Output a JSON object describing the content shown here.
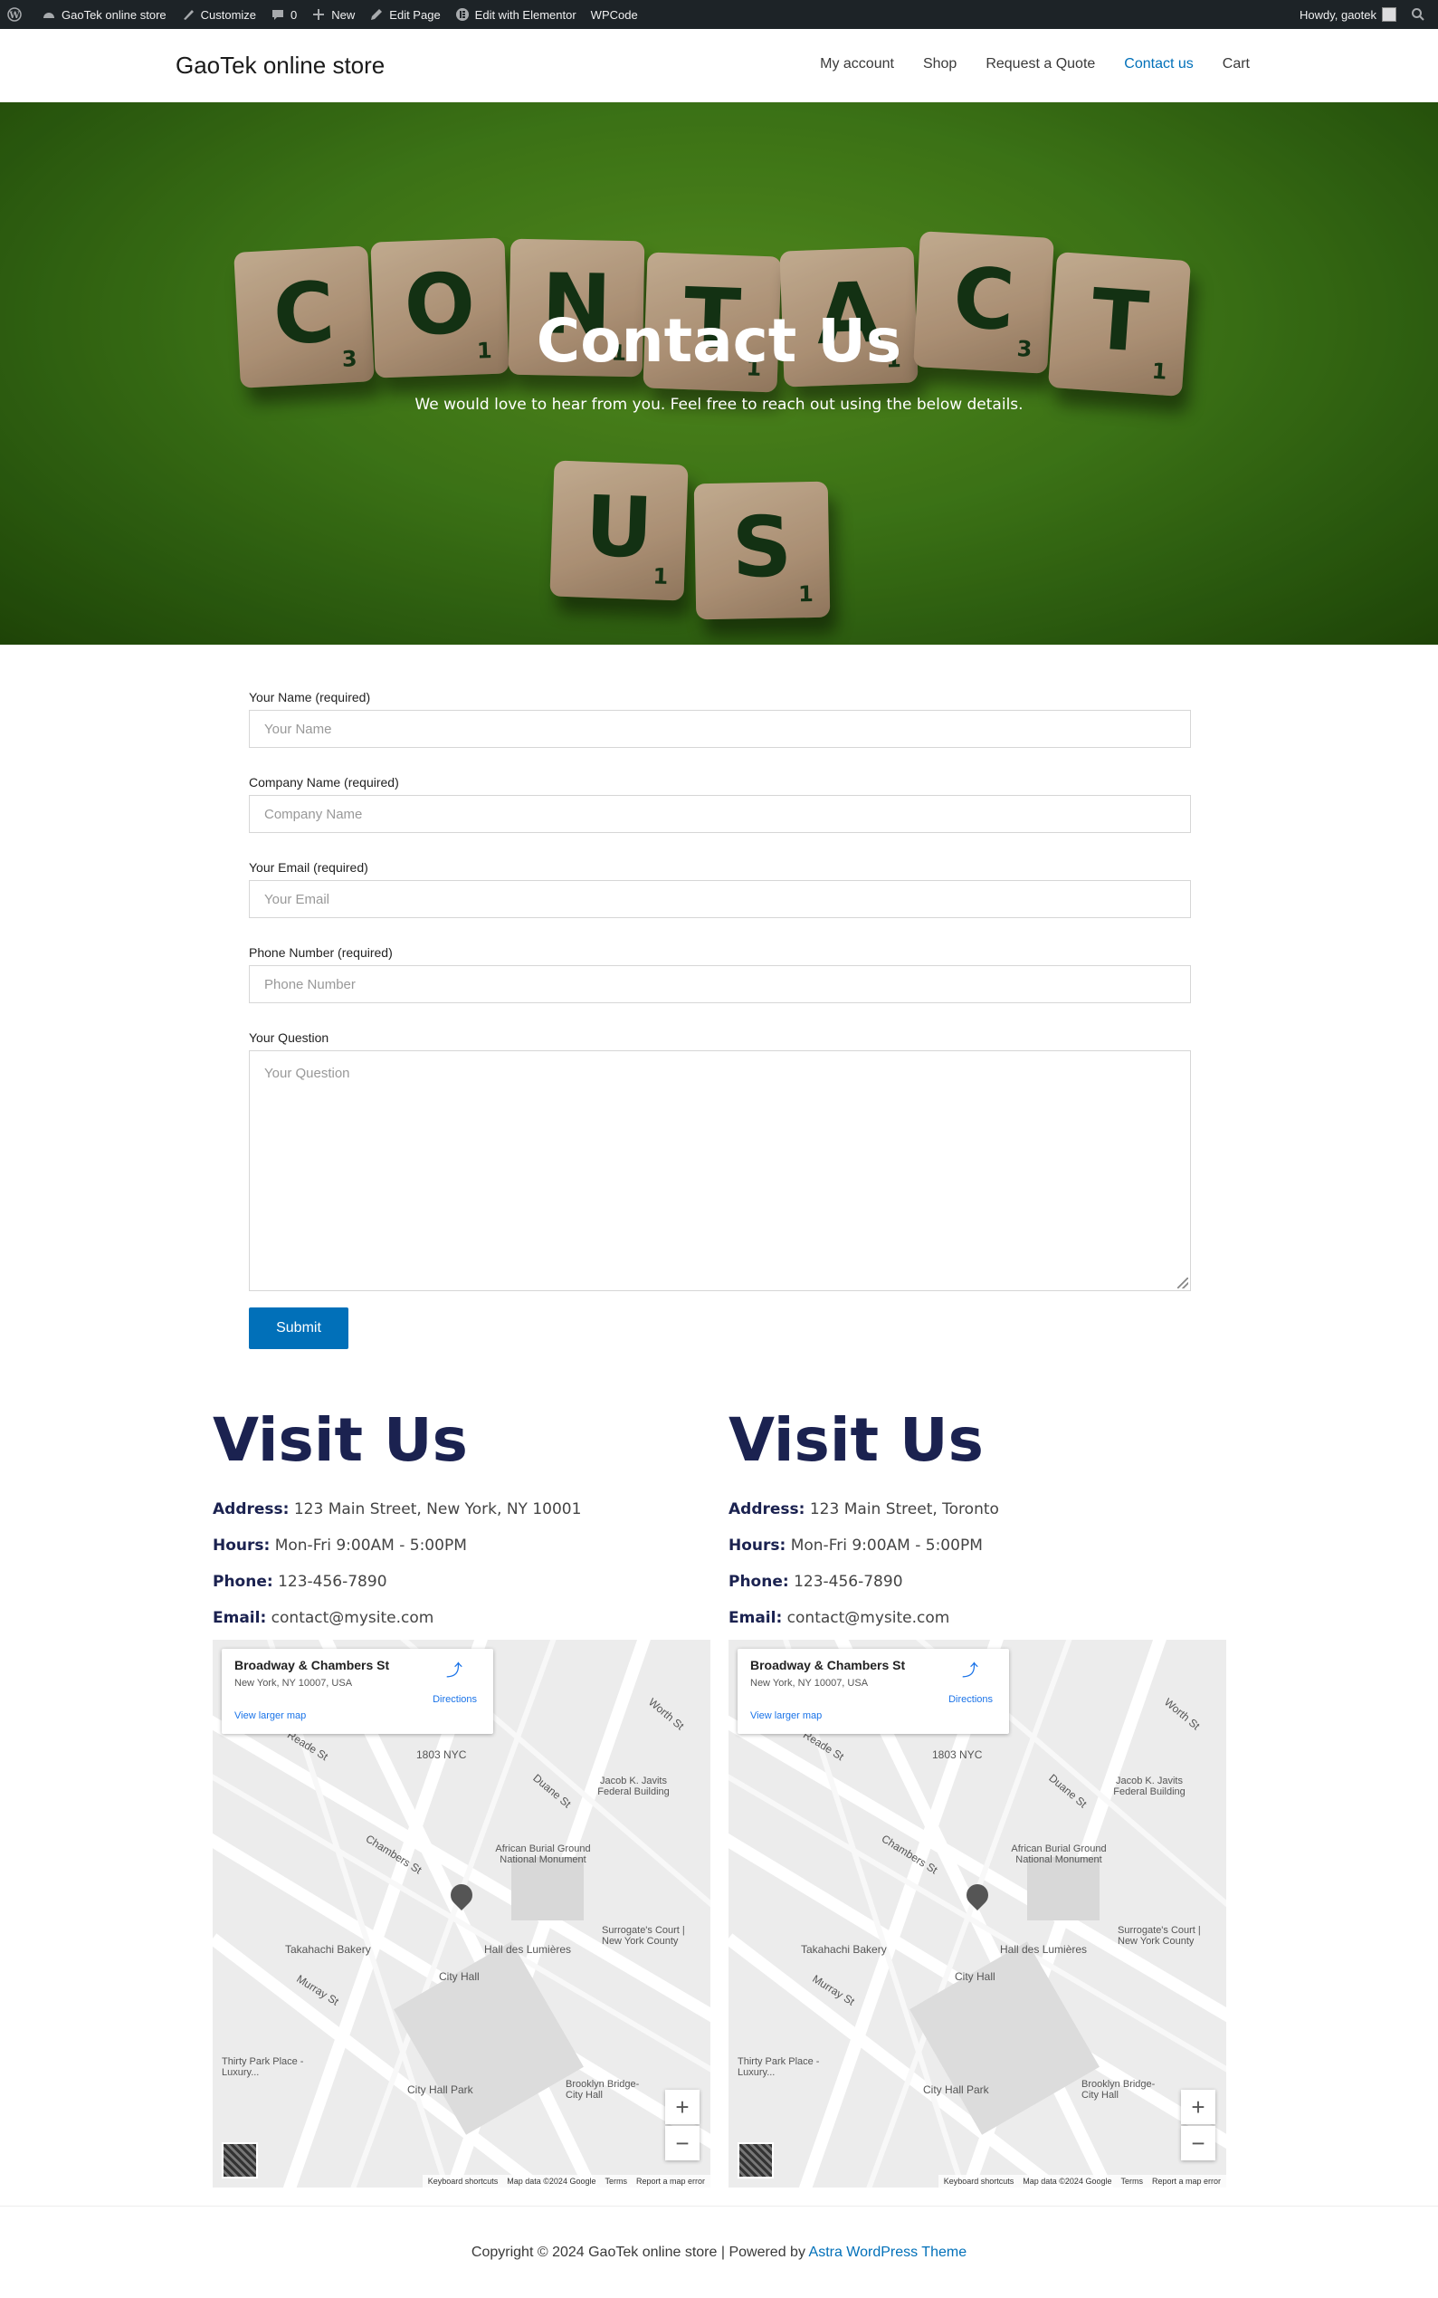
{
  "admin_bar": {
    "site_name": "GaoTek online store",
    "customize": "Customize",
    "comments_count": "0",
    "new": "New",
    "edit_page": "Edit Page",
    "edit_elementor": "Edit with Elementor",
    "wpcode": "WPCode",
    "howdy": "Howdy, gaotek"
  },
  "header": {
    "site_title": "GaoTek online store",
    "nav": [
      "My account",
      "Shop",
      "Request a Quote",
      "Contact us",
      "Cart"
    ],
    "active_nav": "Contact us"
  },
  "hero": {
    "title": "Contact Us",
    "subtitle": "We would love to hear from you. Feel free to reach out using the below details.",
    "tiles_top": [
      {
        "letter": "C",
        "score": "3"
      },
      {
        "letter": "O",
        "score": "1"
      },
      {
        "letter": "N",
        "score": "1"
      },
      {
        "letter": "T",
        "score": "1"
      },
      {
        "letter": "A",
        "score": "1"
      },
      {
        "letter": "C",
        "score": "3"
      },
      {
        "letter": "T",
        "score": "1"
      }
    ],
    "tiles_bottom": [
      {
        "letter": "U",
        "score": "1"
      },
      {
        "letter": "S",
        "score": "1"
      }
    ]
  },
  "form": {
    "name_label": "Your Name (required)",
    "name_placeholder": "Your Name",
    "company_label": "Company Name (required)",
    "company_placeholder": "Company Name",
    "email_label": "Your Email (required)",
    "email_placeholder": "Your Email",
    "phone_label": "Phone Number (required)",
    "phone_placeholder": "Phone Number",
    "question_label": "Your Question",
    "question_placeholder": "Your Question",
    "submit": "Submit"
  },
  "locations": [
    {
      "heading": "Visit Us",
      "address_label": "Address:",
      "address": "123 Main Street, New York, NY 10001",
      "hours_label": "Hours:",
      "hours": "Mon-Fri 9:00AM - 5:00PM",
      "phone_label": "Phone:",
      "phone": "123-456-7890",
      "email_label": "Email:",
      "email": "contact@mysite.com",
      "map": {
        "place": "Broadway & Chambers St",
        "place_address": "New York, NY 10007, USA",
        "larger_map": "View larger map",
        "directions": "Directions"
      }
    },
    {
      "heading": "Visit Us",
      "address_label": "Address:",
      "address": "123 Main Street, Toronto",
      "hours_label": "Hours:",
      "hours": "Mon-Fri 9:00AM - 5:00PM",
      "phone_label": "Phone:",
      "phone": "123-456-7890",
      "email_label": "Email:",
      "email": "contact@mysite.com",
      "map": {
        "place": "Broadway & Chambers St",
        "place_address": "New York, NY 10007, USA",
        "larger_map": "View larger map",
        "directions": "Directions"
      }
    }
  ],
  "map_labels": {
    "street1": "Chambers St",
    "street2": "Reade St",
    "street3": "Duane St",
    "street4": "Murray St",
    "street5": "Worth St",
    "poi1": "African Burial Ground National Monument",
    "poi2": "Hall des Lumières",
    "poi3": "City Hall",
    "poi4": "Takahachi Bakery",
    "poi5": "Jacob K. Javits Federal Building",
    "poi6": "Surrogate's Court | New York County",
    "poi7": "City Hall Park",
    "poi8": "1803 NYC",
    "poi9": "Thirty Park Place - Luxury...",
    "poi10": "Brooklyn Bridge-City Hall",
    "keyboard": "Keyboard shortcuts",
    "mapdata": "Map data ©2024 Google",
    "terms": "Terms",
    "report": "Report a map error",
    "google": "Google"
  },
  "footer": {
    "copyright": "Copyright © 2024 GaoTek online store | Powered by ",
    "theme_link": "Astra WordPress Theme"
  }
}
